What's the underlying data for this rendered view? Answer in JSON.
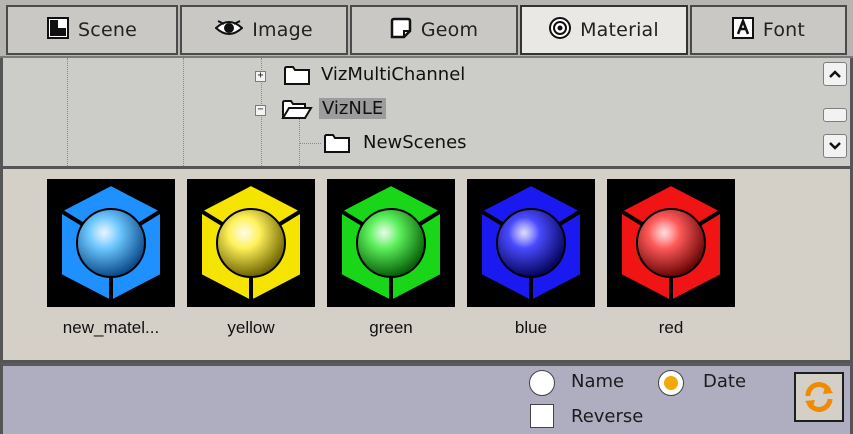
{
  "tabs": [
    {
      "label": "Scene",
      "icon": "scene-icon",
      "active": false
    },
    {
      "label": "Image",
      "icon": "eye-icon",
      "active": false
    },
    {
      "label": "Geom",
      "icon": "geom-icon",
      "active": false
    },
    {
      "label": "Material",
      "icon": "material-icon",
      "active": true
    },
    {
      "label": "Font",
      "icon": "font-icon",
      "active": false
    }
  ],
  "tree": {
    "nodes": [
      {
        "label": "VizMultiChannel",
        "expander": "+",
        "state": "collapsed",
        "selected": false
      },
      {
        "label": "VizNLE",
        "expander": "−",
        "state": "expanded",
        "selected": true
      },
      {
        "label": "NewScenes",
        "expander": "",
        "state": "leaf",
        "selected": false
      }
    ]
  },
  "materials": [
    {
      "name": "new_matel...",
      "color": "#1e90ff"
    },
    {
      "name": "yellow",
      "color": "#f5e400"
    },
    {
      "name": "green",
      "color": "#19d619"
    },
    {
      "name": "blue",
      "color": "#1a1af0"
    },
    {
      "name": "red",
      "color": "#f01414"
    }
  ],
  "sort": {
    "name_label": "Name",
    "date_label": "Date",
    "reverse_label": "Reverse",
    "selected": "Date",
    "reverse_checked": false,
    "accent": "#f4a80a"
  },
  "colors": {
    "tab_bar": "#b6b5b2",
    "tree_bg": "#ccccc9",
    "sort_bar": "#afaec0",
    "refresh_orange": "#f08a00"
  }
}
